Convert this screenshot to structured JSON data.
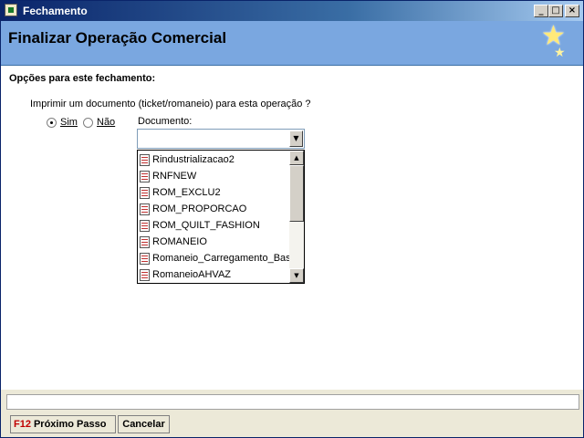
{
  "window": {
    "title": "Fechamento",
    "controls": {
      "minimize": "_",
      "maximize": "□",
      "close": "×"
    }
  },
  "banner": {
    "heading": "Finalizar Operação Comercial",
    "decoration_icon": "stars-icon"
  },
  "main": {
    "section_title": "Opções para este fechamento:",
    "question": "Imprimir um documento (ticket/romaneio) para esta operação ?",
    "radio_options": [
      {
        "label": "Sim",
        "checked": true
      },
      {
        "label": "Não",
        "checked": false
      }
    ],
    "document_label": "Documento:",
    "document_value": "",
    "document_list": [
      "Rindustrializacao2",
      "RNFNEW",
      "ROM_EXCLU2",
      "ROM_PROPORCAO",
      "ROM_QUILT_FASHION",
      "ROMANEIO",
      "Romaneio_Carregamento_Basilio",
      "RomaneioAHVAZ"
    ]
  },
  "status": {
    "text": ""
  },
  "footer": {
    "next_key": "F12",
    "next_label": "Próximo Passo",
    "cancel_label": "Cancelar"
  },
  "colors": {
    "titlebar": "#0a246a",
    "banner": "#7aa7e0",
    "key_accent": "#c00000"
  }
}
